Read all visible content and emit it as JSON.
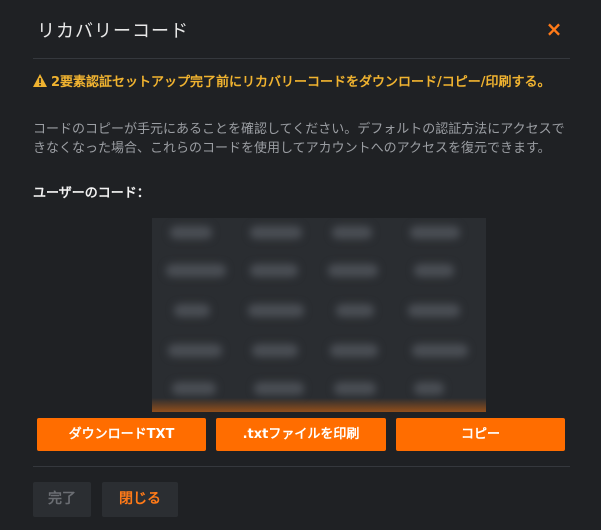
{
  "dialog": {
    "title": "リカバリーコード",
    "close_label": "×"
  },
  "warning": {
    "text": "2要素認証セットアップ完了前にリカバリーコードをダウンロード/コピー/印刷する。"
  },
  "description": "コードのコピーが手元にあることを確認してください。デフォルトの認証方法にアクセスできなくなった場合、これらのコードを使用してアカウントへのアクセスを復元できます。",
  "codes": {
    "label": "ユーザーのコード："
  },
  "actions": {
    "download_label": "ダウンロードTXT",
    "print_label": ".txtファイルを印刷",
    "copy_label": "コピー"
  },
  "footer": {
    "done_label": "完了",
    "close_label": "閉じる"
  },
  "colors": {
    "accent": "#ff6d00",
    "warning": "#f0b330",
    "background": "#1f2124"
  }
}
